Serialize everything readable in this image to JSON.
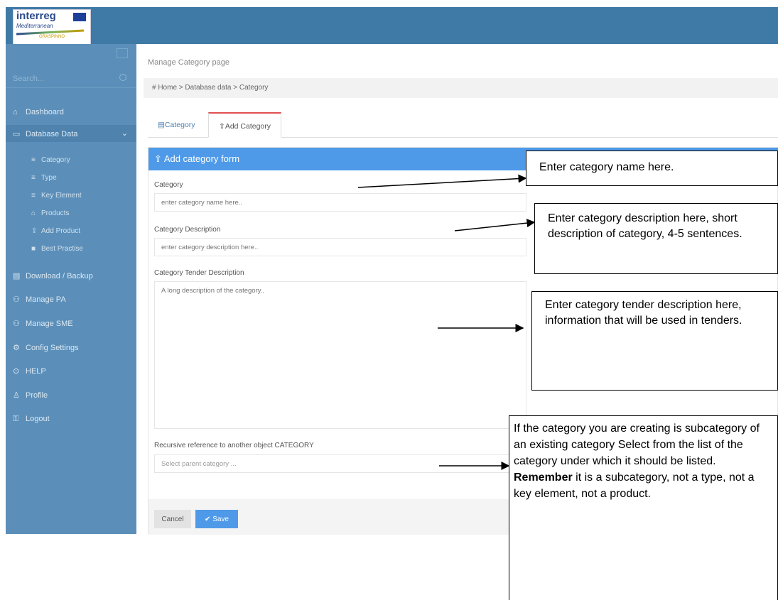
{
  "sidebar": {
    "search_placeholder": "Search...",
    "items": [
      {
        "label": "Dashboard",
        "icon": "home-icon"
      },
      {
        "label": "Database Data",
        "icon": "folder-icon"
      },
      {
        "label": "Download / Backup",
        "icon": "database-icon"
      },
      {
        "label": "Manage PA",
        "icon": "users-icon"
      },
      {
        "label": "Manage SME",
        "icon": "users-icon"
      },
      {
        "label": "Config Settings",
        "icon": "gear-icon"
      },
      {
        "label": "HELP",
        "icon": "pin-icon"
      },
      {
        "label": "Profile",
        "icon": "user-icon"
      },
      {
        "label": "Logout",
        "icon": "lock-icon"
      }
    ],
    "sub_items": [
      {
        "label": "Category",
        "icon": "list-icon"
      },
      {
        "label": "Type",
        "icon": "list-icon"
      },
      {
        "label": "Key Element",
        "icon": "list-icon"
      },
      {
        "label": "Products",
        "icon": "bag-icon"
      },
      {
        "label": "Add Product",
        "icon": "upload-icon"
      },
      {
        "label": "Best Practise",
        "icon": "folder-icon"
      }
    ]
  },
  "page": {
    "title": "Manage Category page",
    "breadcrumb": "# Home  >  Database data  >  Category"
  },
  "tabs": [
    {
      "label": "Category"
    },
    {
      "label": "Add Category"
    }
  ],
  "form": {
    "header": "Add category form",
    "category_label": "Category",
    "category_placeholder": "enter category name here..",
    "description_label": "Category Description",
    "description_placeholder": "enter category description here..",
    "tender_label": "Category Tender Description",
    "tender_placeholder": "A long description of the category..",
    "parent_label": "Recursive reference to another object CATEGORY",
    "parent_placeholder": "Select parent category ...",
    "cancel_label": "Cancel",
    "save_label": "Save"
  },
  "callouts": {
    "c1": "Enter category name here.",
    "c2": "Enter category description here, short description of category, 4-5 sentences.",
    "c3": "Enter category tender description here, information that will be used in tenders.",
    "c4_before": "If the category you are creating is subcategory of an existing category Select from the list of the category under which it should be listed. ",
    "c4_bold": "Remember",
    "c4_after": " it is a subcategory, not a type, not a key element, not a product."
  },
  "colors": {
    "header": "#3f7aa6",
    "sidebar": "#5b8fb9",
    "panel_header": "#4f9ae8",
    "active_tab_border": "#e05050"
  }
}
